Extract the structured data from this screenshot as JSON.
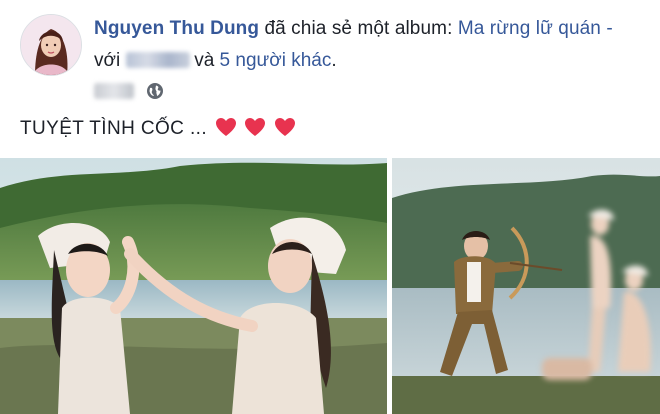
{
  "post": {
    "author": "Nguyen Thu Dung",
    "action_text": " đã chia sẻ một album: ",
    "album_title": "Ma rừng lữ quán -",
    "with_text": "với",
    "and_text": "và ",
    "others_link": "5 người khác",
    "trailing_period": ".",
    "privacy_icon": "globe-icon",
    "status_text": "TUYỆT TÌNH CỐC ...",
    "emoji": [
      "heart",
      "heart",
      "heart"
    ]
  },
  "colors": {
    "link": "#365899",
    "text": "#1d2129",
    "heart": "#e8334f"
  }
}
